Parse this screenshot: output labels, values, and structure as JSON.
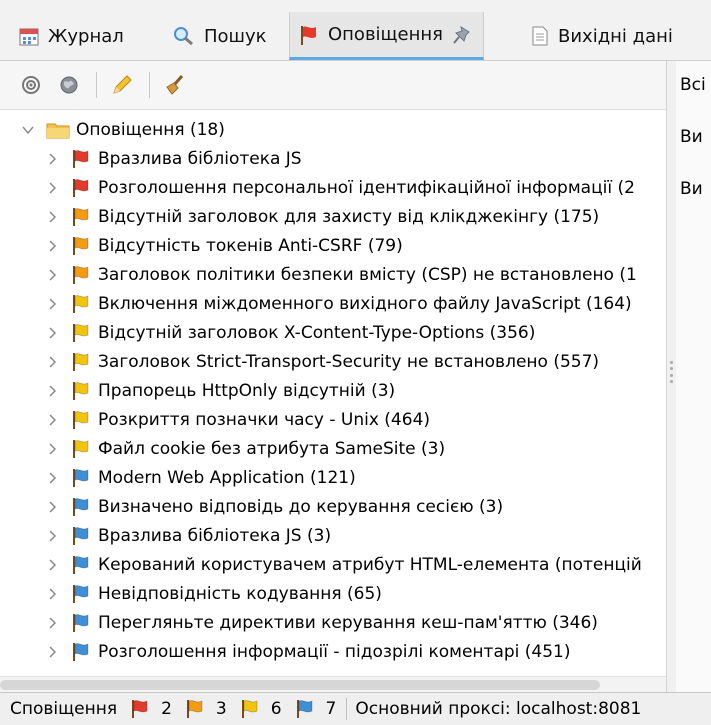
{
  "tabs": [
    {
      "label": "Журнал",
      "icon": "calendar-icon"
    },
    {
      "label": "Пошук",
      "icon": "magnifier-icon"
    },
    {
      "label": "Оповіщення",
      "icon": "red-flag-icon",
      "active": true
    },
    {
      "label": "Вихідні дані",
      "icon": "document-icon"
    }
  ],
  "toolbar": {
    "icons": [
      "target-icon",
      "globe-icon",
      "pencil-icon",
      "broom-icon"
    ]
  },
  "tree": {
    "root": "Оповіщення (18)",
    "items": [
      {
        "label": "Вразлива бібліотека JS",
        "level": "high"
      },
      {
        "label": "Розголошення персональної ідентифікаційної інформації (2",
        "level": "high"
      },
      {
        "label": "Відсутній заголовок для захисту від клікджекінгу (175)",
        "level": "medium"
      },
      {
        "label": "Відсутність токенів Anti-CSRF (79)",
        "level": "medium"
      },
      {
        "label": "Заголовок політики безпеки вмісту (CSP) не встановлено (1",
        "level": "medium"
      },
      {
        "label": "Включення міждоменного вихідного файлу JavaScript (164)",
        "level": "low"
      },
      {
        "label": "Відсутній заголовок X-Content-Type-Options (356)",
        "level": "low"
      },
      {
        "label": "Заголовок Strict-Transport-Security не встановлено (557)",
        "level": "low"
      },
      {
        "label": "Прапорець HttpOnly відсутній (3)",
        "level": "low"
      },
      {
        "label": "Розкриття позначки часу - Unix (464)",
        "level": "low"
      },
      {
        "label": "Файл cookie без атрибута SameSite (3)",
        "level": "low"
      },
      {
        "label": "Modern Web Application (121)",
        "level": "info"
      },
      {
        "label": "Визначено відповідь до керування сесією (3)",
        "level": "info"
      },
      {
        "label": "Вразлива бібліотека JS (3)",
        "level": "info"
      },
      {
        "label": "Керований користувачем атрибут HTML-елемента (потенцій",
        "level": "info"
      },
      {
        "label": "Невідповідність кодування  (65)",
        "level": "info"
      },
      {
        "label": "Перегляньте директиви керування кеш-пам'яттю (346)",
        "level": "info"
      },
      {
        "label": "Розголошення інформації - підозрілі коментарі (451)",
        "level": "info"
      }
    ]
  },
  "right_pane": [
    "Всі",
    "Ви",
    "Ви"
  ],
  "status": {
    "label": "Сповіщення",
    "counts": [
      {
        "level": "high",
        "value": "2"
      },
      {
        "level": "medium",
        "value": "3"
      },
      {
        "level": "low",
        "value": "6"
      },
      {
        "level": "info",
        "value": "7"
      }
    ],
    "proxy": "Основний проксі: localhost:8081"
  },
  "colors": {
    "high": "#e23b2e",
    "medium": "#f39c12",
    "low": "#f1c40f",
    "info": "#3f8fd6",
    "folder": "#f2c14e"
  }
}
